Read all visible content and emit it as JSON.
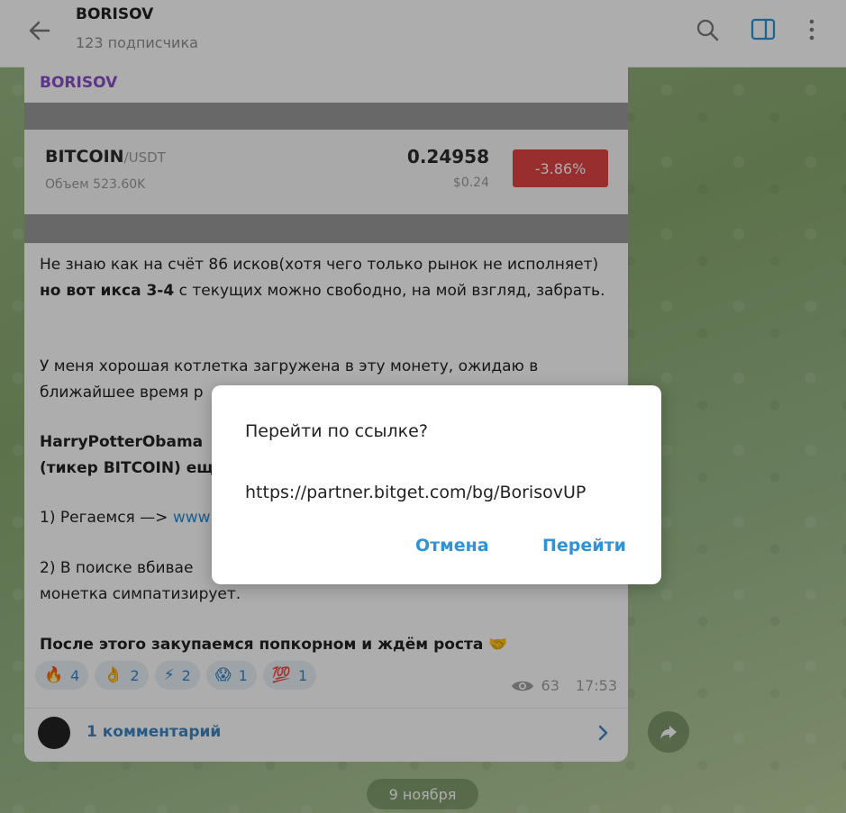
{
  "header": {
    "title": "BORISOV",
    "subtitle": "123 подписчика",
    "icons": [
      "back-arrow-icon",
      "search-icon",
      "sidebar-toggle-icon",
      "more-vertical-icon"
    ]
  },
  "post": {
    "author": "BORISOV",
    "ticker_card": {
      "coin": "BITCOIN",
      "pair": "/USDT",
      "volume": "Объем 523.60K",
      "price": "0.24958",
      "price_usd": "$0.24",
      "change": "-3.86%",
      "change_color": "#e04545"
    },
    "paragraphs": {
      "p1_a": "Не знаю как на счёт 86 исков(хотя чего только рынок не исполняет) ",
      "p1_b": "но вот икса 3-4",
      "p1_c": " с текущих можно свободно, на мой взгляд, забрать.",
      "p2": "У меня хорошая котлетка загружена в эту монету, ожидаю в ближайшее время р",
      "p3_l1": "HarryPotterObama",
      "p3_l2": "(тикер BITCOIN) ещ",
      "p4_a": "1) Регаемся —> ",
      "p4_link": "www",
      "p5_l1": "2) В поиске вбивае",
      "p5_l2": "монетка симпатизирует.",
      "p6": "После этого закупаемся попкорном и ждём роста 🤝"
    },
    "reactions": [
      {
        "emoji": "🔥",
        "count": "4"
      },
      {
        "emoji": "👌",
        "count": "2"
      },
      {
        "emoji": "⚡",
        "count": "2"
      },
      {
        "emoji": "😱",
        "count": "1"
      },
      {
        "emoji": "💯",
        "count": "1"
      }
    ],
    "views": "63",
    "time": "17:53",
    "comments": "1 комментарий"
  },
  "date_pill": "9 ноября",
  "dialog": {
    "title": "Перейти по ссылке?",
    "url": "https://partner.bitget.com/bg/BorisovUP",
    "cancel": "Отмена",
    "confirm": "Перейти"
  },
  "colors": {
    "accent": "#2f93d6",
    "author": "#8a4fc6",
    "reaction_text": "#3a86c4"
  }
}
